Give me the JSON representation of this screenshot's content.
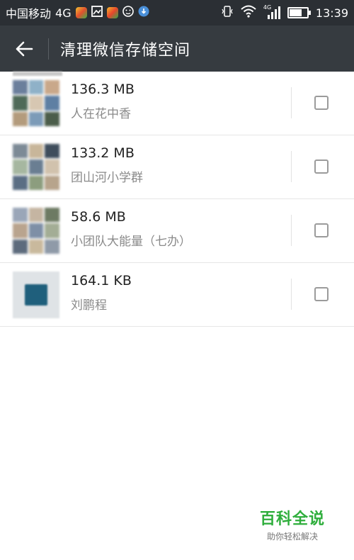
{
  "status_bar": {
    "carrier": "中国移动",
    "network": "4G",
    "signal_tag": "4G",
    "time": "13:39",
    "battery_level": 0.7
  },
  "app_bar": {
    "back_icon": "arrow-left-icon",
    "title": "清理微信存储空间"
  },
  "items": [
    {
      "size": "136.3 MB",
      "name": "人在花中香",
      "checked": false
    },
    {
      "size": "133.2 MB",
      "name": "团山河小学群",
      "checked": false
    },
    {
      "size": "58.6 MB",
      "name": "小团队大能量（七办）",
      "checked": false
    },
    {
      "size": "164.1 KB",
      "name": "刘鹏程",
      "checked": false
    }
  ],
  "watermark": {
    "main": "百科全说",
    "sub": "助你轻松解决"
  },
  "colors": {
    "status_bar_bg": "#2b2f34",
    "app_bar_bg": "#363b40",
    "watermark_green": "#2fae3c"
  }
}
